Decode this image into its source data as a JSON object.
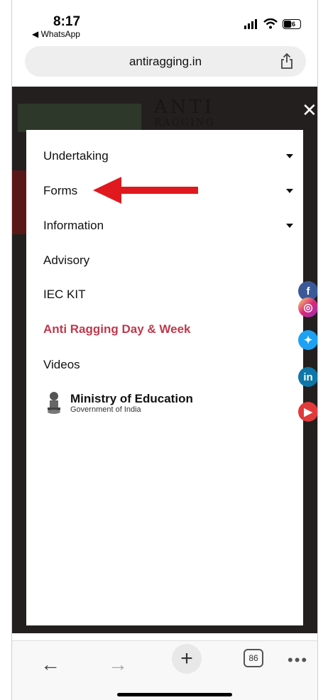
{
  "status": {
    "time": "8:17",
    "back_app": "◀ WhatsApp",
    "battery": "26"
  },
  "browser": {
    "url": "antiragging.in",
    "tab_count": "86"
  },
  "menu": {
    "items": [
      {
        "label": "Undertaking"
      },
      {
        "label": "Forms"
      },
      {
        "label": "Information"
      },
      {
        "label": "Advisory"
      },
      {
        "label": "IEC KIT"
      },
      {
        "label": "Anti Ragging Day & Week"
      },
      {
        "label": "Videos"
      }
    ],
    "ministry_title": "Ministry of Education",
    "ministry_sub": "Government of India"
  },
  "banner": {
    "title_line1": "ANTI",
    "title_line2": "RAGGING"
  },
  "social_icons": [
    "facebook-icon",
    "instagram-icon",
    "twitter-icon",
    "linkedin-icon",
    "youtube-icon"
  ],
  "colors": {
    "accent_red": "#c0394b",
    "dark_bg": "#231f1f"
  }
}
